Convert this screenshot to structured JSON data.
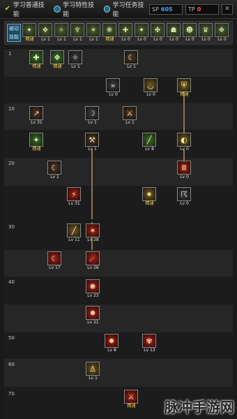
{
  "tabs": [
    {
      "label": "学习普通技能",
      "icon": "check-icon"
    },
    {
      "label": "学习特性技能",
      "icon": "radio-icon"
    },
    {
      "label": "学习任务技能",
      "icon": "radio-icon"
    }
  ],
  "points": {
    "sp_label": "SP",
    "sp_value": "605",
    "tp_label": "TP",
    "tp_value": "0"
  },
  "quickbar": {
    "label": "被动技能",
    "slots": [
      "精通",
      "Lv 1",
      "Lv 1",
      "Lv 1",
      "Lv 1",
      "精通",
      "Lv 0",
      "Lv 0",
      "Lv 0",
      "Lv 0",
      "Lv 0",
      "Lv 0",
      "Lv 0"
    ]
  },
  "levels": [
    "1",
    "10",
    "20",
    "30",
    "40",
    "50",
    "60",
    "70"
  ],
  "skills_top": [
    {
      "lv": "精通"
    },
    {
      "lv": "精通"
    },
    {
      "lv": "Lv 1"
    },
    {
      "lv": "Lv 1"
    },
    {
      "lv": "Lv 0"
    },
    {
      "lv": "Lv 0"
    },
    {
      "lv": "精通"
    },
    {
      "lv": "Lv 31"
    },
    {
      "lv": "Lv 1"
    },
    {
      "lv": "Lv 1"
    },
    {
      "lv": "精通"
    },
    {
      "lv": "Lv 1"
    },
    {
      "lv": "Lv 8"
    },
    {
      "lv": "Lv 0"
    },
    {
      "lv": "Lv 1"
    },
    {
      "lv": "Lv 0"
    },
    {
      "lv": "Lv 31"
    },
    {
      "lv": "精通"
    },
    {
      "lv": "Lv 0"
    }
  ],
  "skills_bottom": [
    {
      "lv": "Lv 11"
    },
    {
      "lv": "Lv 28"
    },
    {
      "lv": "Lv 17"
    },
    {
      "lv": "Lv 26"
    },
    {
      "lv": "Lv 23"
    },
    {
      "lv": "Lv 21"
    },
    {
      "lv": "Lv 8"
    },
    {
      "lv": "Lv 13"
    },
    {
      "lv": "Lv 1"
    },
    {
      "lv": "精通"
    }
  ],
  "watermark": "脉冲手游网"
}
